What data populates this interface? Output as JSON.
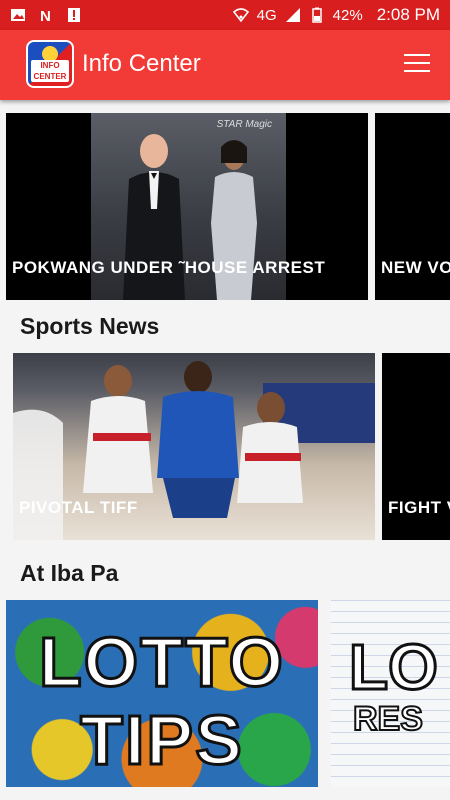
{
  "status_bar": {
    "network": "4G",
    "battery": "42%",
    "time": "2:08 PM"
  },
  "app_bar": {
    "logo_text_top": "INFO",
    "logo_text_bottom": "CENTER",
    "title": "Info Center"
  },
  "featured": {
    "cards": [
      {
        "label": "POKWANG UNDER ˜HOUSE ARREST"
      },
      {
        "label": "NEW VO"
      }
    ],
    "photo_caption": "STAR Magic"
  },
  "sports": {
    "title": "Sports News",
    "cards": [
      {
        "label": "PIVOTAL TIFF"
      },
      {
        "label": "FIGHT V"
      }
    ]
  },
  "other": {
    "title": "At Iba Pa",
    "cards": [
      {
        "line1": "LOTTO",
        "line2": "TIPS"
      },
      {
        "line1": "LO",
        "line2": "RES"
      }
    ]
  },
  "colors": {
    "status_bar": "#d81e1e",
    "app_bar": "#f23a36",
    "background": "#f4f4f4"
  }
}
